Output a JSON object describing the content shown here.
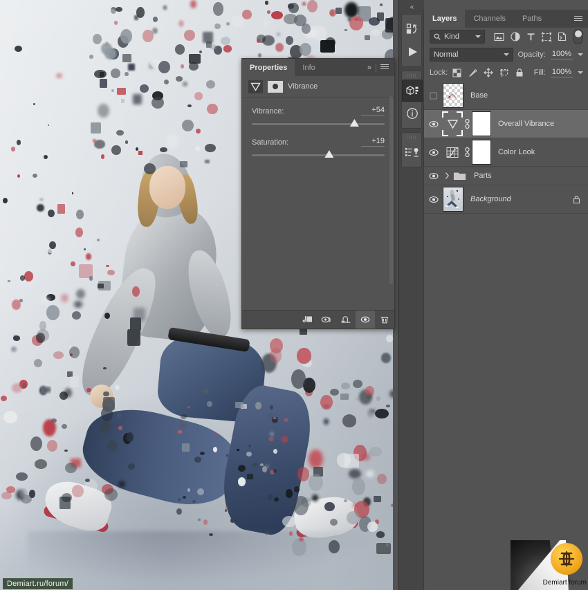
{
  "dock": {
    "collapse_label": "«",
    "buttons": [
      {
        "name": "history-icon",
        "title": "History"
      },
      {
        "name": "play-icon",
        "title": "Play"
      },
      {
        "name": "3d-panel-icon",
        "title": "3D",
        "selected": true
      },
      {
        "name": "info-icon",
        "title": "Info"
      },
      {
        "name": "adjustments-styles-icon",
        "title": "Adjustments"
      }
    ]
  },
  "properties": {
    "tabs": [
      {
        "label": "Properties",
        "active": true
      },
      {
        "label": "Info",
        "active": false
      }
    ],
    "overflow_label": "»",
    "menu_icon": "hamburger-menu-icon",
    "adjustment_type": "Vibrance",
    "adjustment_icon": "vibrance-icon",
    "mask_icon": "layer-mask-icon",
    "sliders": [
      {
        "label": "Vibrance:",
        "value": "+54",
        "percent": 77
      },
      {
        "label": "Saturation:",
        "value": "+19",
        "percent": 58
      }
    ],
    "footer_buttons": [
      {
        "name": "clip-to-layer-icon",
        "active": false
      },
      {
        "name": "view-previous-state-icon",
        "active": false
      },
      {
        "name": "reset-icon",
        "active": false
      },
      {
        "name": "toggle-visibility-icon",
        "active": true
      },
      {
        "name": "delete-icon",
        "active": false
      }
    ]
  },
  "layers_panel": {
    "tabs": [
      {
        "label": "Layers",
        "active": true
      },
      {
        "label": "Channels",
        "active": false
      },
      {
        "label": "Paths",
        "active": false
      }
    ],
    "menu_icon": "hamburger-menu-icon",
    "filter": {
      "search_icon": "search-icon",
      "kind_label": "Kind",
      "chevron": "chevron-down-icon",
      "type_icons": [
        "filter-image-icon",
        "filter-adjustment-icon",
        "filter-type-icon",
        "filter-shape-icon",
        "filter-smart-object-icon"
      ],
      "power_toggle": "filter-toggle-switch"
    },
    "blend": {
      "mode": "Normal",
      "opacity_label": "Opacity:",
      "opacity_value": "100%"
    },
    "lock": {
      "label": "Lock:",
      "icons": [
        "lock-transparent-pixels-icon",
        "lock-image-pixels-icon",
        "lock-position-icon",
        "lock-artboard-icon",
        "lock-all-icon"
      ],
      "fill_label": "Fill:",
      "fill_value": "100%"
    },
    "layers": [
      {
        "name": "Base",
        "visible": false,
        "selected": false,
        "thumb": "transparent-checker",
        "kind": "pixel",
        "italic": false,
        "locked": false,
        "has_mask": false
      },
      {
        "name": "Overall Vibrance",
        "visible": true,
        "selected": true,
        "thumb": "vibrance-adjustment",
        "kind": "adjustment",
        "italic": false,
        "locked": false,
        "has_mask": true,
        "link_icon": "link-icon"
      },
      {
        "name": "Color Look",
        "visible": true,
        "selected": false,
        "thumb": "gradient-map-adjustment",
        "kind": "adjustment",
        "italic": false,
        "locked": false,
        "has_mask": true,
        "link_icon": "link-icon"
      },
      {
        "name": "Parts",
        "visible": true,
        "selected": false,
        "thumb": "folder",
        "kind": "group",
        "italic": false,
        "locked": false,
        "has_mask": false,
        "disclosure": "chevron-right-icon"
      },
      {
        "name": "Background",
        "visible": true,
        "selected": false,
        "thumb": "dancer-photo",
        "kind": "pixel",
        "italic": true,
        "locked": true,
        "has_mask": false,
        "lock_icon": "lock-icon"
      }
    ]
  },
  "watermarks": {
    "forum_url": "Demiart.ru/forum/",
    "logo_caption": "Demiart forum",
    "logo_icon": "demiart-logo-icon"
  },
  "colors": {
    "panel_bg": "#535353",
    "panel_tab_bg": "#444444",
    "selected_layer": "#6a6a6a",
    "text": "#dcdcdc",
    "watermark_green": "#3f5340",
    "logo_orange": "#f0a81e"
  }
}
